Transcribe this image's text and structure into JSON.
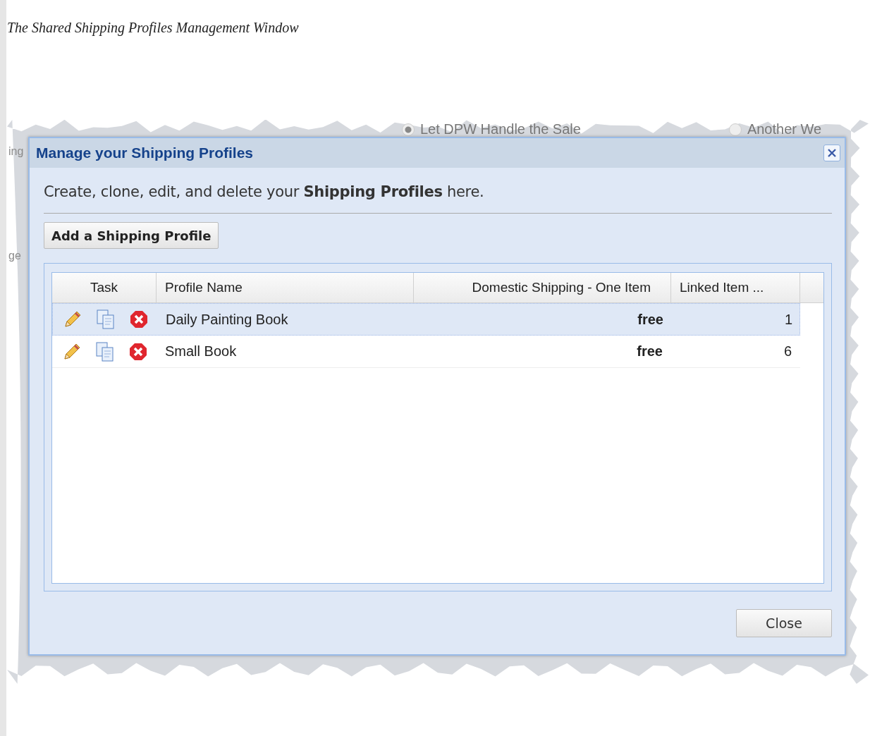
{
  "caption": "The Shared Shipping Profiles Management Window",
  "background": {
    "radios": [
      {
        "label": "Let DPW Handle the Sale",
        "selected": true
      },
      {
        "label": "Another We",
        "selected": false
      }
    ],
    "fragments": [
      "ing",
      "ge"
    ]
  },
  "dialog": {
    "title": "Manage your Shipping Profiles",
    "intro": "Create, clone, edit, and delete your **Shipping Profiles** here.",
    "add_button": "Add a Shipping Profile",
    "columns": [
      "Task",
      "Profile Name",
      "Domestic Shipping - One Item",
      "Linked Item ..."
    ],
    "rows": [
      {
        "name": "Daily Painting Book",
        "shipping": "free",
        "linked": "1",
        "selected": true
      },
      {
        "name": "Small Book",
        "shipping": "free",
        "linked": "6",
        "selected": false
      }
    ],
    "close_button": "Close"
  }
}
